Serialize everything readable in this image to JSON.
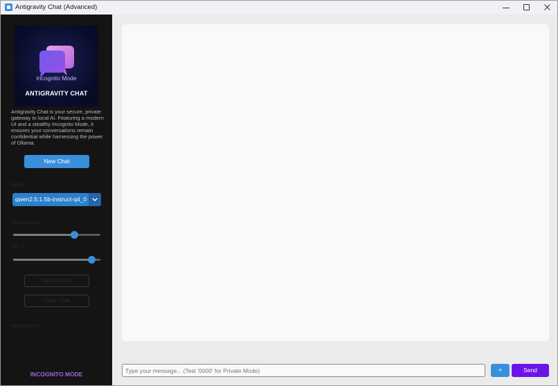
{
  "window": {
    "title": "Antigravity Chat (Advanced)",
    "icon": "app-icon"
  },
  "sidebar": {
    "logo": {
      "overlay_text": "Incognito Mode",
      "title": "ANTIGRAVITY CHAT"
    },
    "description": "Antigravity Chat is your secure, private gateway to local AI. Featuring a modern UI and a stealthy Incognito Mode, it ensures your conversations remain confidential while harnessing the power of Ollama.",
    "new_chat_label": "New Chat",
    "model_label": "Model",
    "model_selected": "qwen2.5:1.5b-instruct-q4_0",
    "temperature_label": "Temperature",
    "temperature_value": 0.7,
    "topp_label": "Top P",
    "topp_value": 0.9,
    "save_button_label": "Save History",
    "clear_button_label": "Clear Chat",
    "appearance_label": "Appearance",
    "incognito_label": "INCOGNITO MODE"
  },
  "composer": {
    "placeholder": "Type your message... (Test '0000' for Private Mode)",
    "plus_label": "+",
    "send_label": "Send"
  },
  "colors": {
    "accent": "#3a8fdc",
    "send": "#6b14ea",
    "incognito": "#9a66e8",
    "sidebar_bg": "#141414"
  }
}
